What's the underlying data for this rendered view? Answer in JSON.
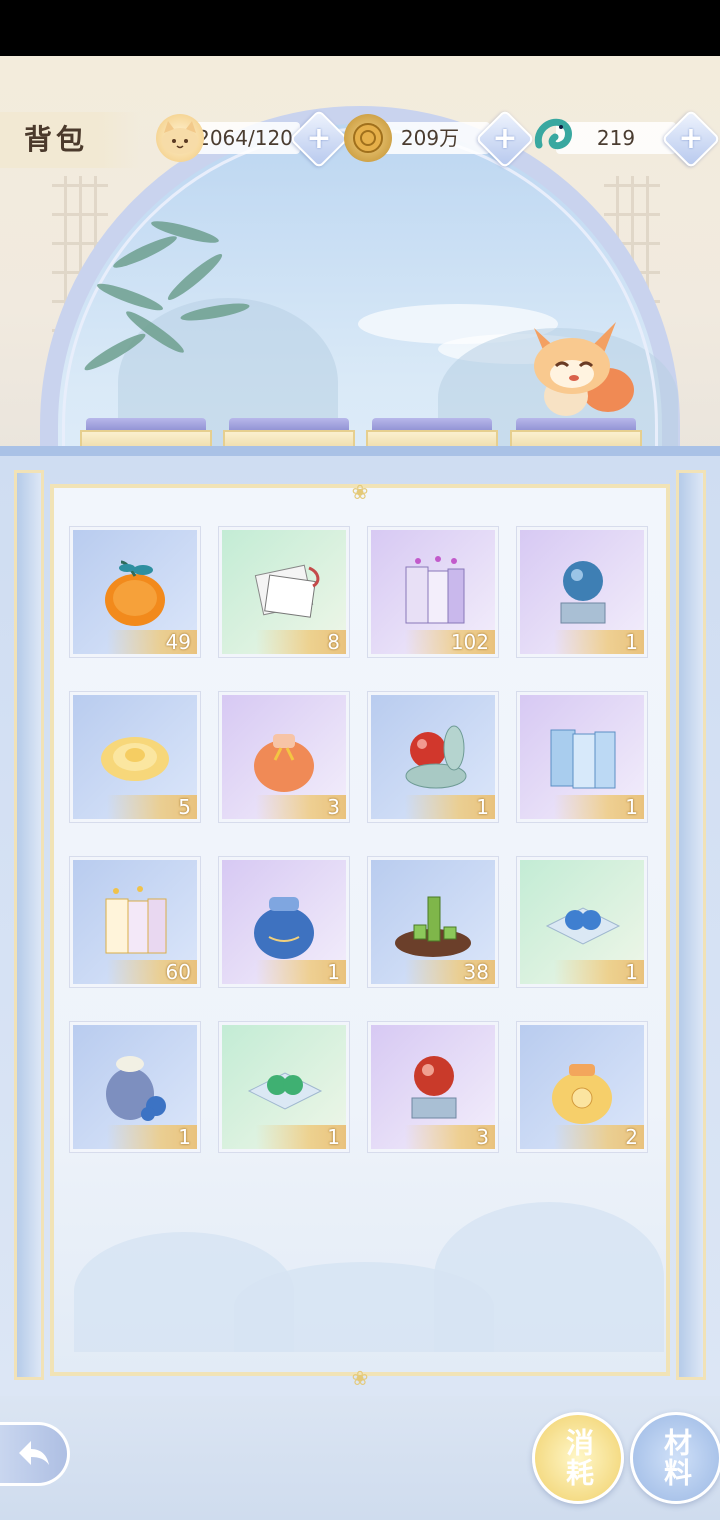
{
  "header": {
    "title": "背包",
    "resources": [
      {
        "icon": "cat-face-icon",
        "value": "2064/120"
      },
      {
        "icon": "gold-coin-icon",
        "value": "209万"
      },
      {
        "icon": "jade-dragon-icon",
        "value": "219"
      }
    ],
    "plus_label": "+"
  },
  "items": [
    {
      "name": "orange-fruit",
      "count": "49",
      "bg": "blue"
    },
    {
      "name": "scroll-papers",
      "count": "8",
      "bg": "green"
    },
    {
      "name": "music-score-books",
      "count": "102",
      "bg": "purple"
    },
    {
      "name": "blue-pearl-on-box",
      "count": "1",
      "bg": "purple"
    },
    {
      "name": "golden-rose",
      "count": "5",
      "bg": "blue"
    },
    {
      "name": "orange-pouch",
      "count": "3",
      "bg": "purple"
    },
    {
      "name": "red-pearl-case",
      "count": "1",
      "bg": "blue"
    },
    {
      "name": "blue-score-books",
      "count": "1",
      "bg": "purple"
    },
    {
      "name": "golden-score-books",
      "count": "60",
      "bg": "blue"
    },
    {
      "name": "blue-pouch",
      "count": "1",
      "bg": "purple"
    },
    {
      "name": "bamboo-tray",
      "count": "38",
      "bg": "blue"
    },
    {
      "name": "blue-beads-cloth",
      "count": "1",
      "bg": "green"
    },
    {
      "name": "blue-gourd-bag",
      "count": "1",
      "bg": "blue"
    },
    {
      "name": "green-beads-cloth",
      "count": "1",
      "bg": "green"
    },
    {
      "name": "red-pearl-on-box",
      "count": "3",
      "bg": "purple"
    },
    {
      "name": "golden-pouch",
      "count": "2",
      "bg": "blue"
    }
  ],
  "footer": {
    "tabs": [
      {
        "label": "消耗",
        "active": true
      },
      {
        "label": "材料",
        "active": false
      }
    ]
  }
}
